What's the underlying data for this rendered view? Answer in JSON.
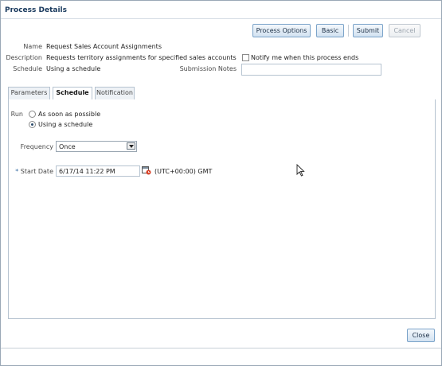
{
  "dialog": {
    "title": "Process Details"
  },
  "toolbar": {
    "process_options": "Process Options",
    "basic": "Basic",
    "submit": "Submit",
    "cancel": "Cancel"
  },
  "info": {
    "name_label": "Name",
    "name_value": "Request Sales Account Assignments",
    "description_label": "Description",
    "description_value": "Requests territory assignments for specified sales accounts",
    "schedule_label": "Schedule",
    "schedule_value": "Using a schedule",
    "notify_label": "Notify me when this process ends",
    "notify_checked": false,
    "submission_notes_label": "Submission Notes",
    "submission_notes_value": ""
  },
  "tabs": [
    {
      "label": "Parameters",
      "active": false
    },
    {
      "label": "Schedule",
      "active": true
    },
    {
      "label": "Notification",
      "active": false
    }
  ],
  "schedule_tab": {
    "run_label": "Run",
    "run_options": [
      {
        "label": "As soon as possible",
        "selected": false
      },
      {
        "label": "Using a schedule",
        "selected": true
      }
    ],
    "frequency_label": "Frequency",
    "frequency_value": "Once",
    "required_marker": "*",
    "start_date_label": "Start Date",
    "start_date_value": "6/17/14 11:22 PM",
    "timezone": "(UTC+00:00) GMT"
  },
  "footer": {
    "close": "Close"
  },
  "icons": {
    "calendar": "calendar-icon",
    "cursor": "mouse-pointer-icon"
  },
  "colors": {
    "accent": "#1a3a5e",
    "required": "#3a6ea5",
    "border": "#b6c3d0"
  }
}
